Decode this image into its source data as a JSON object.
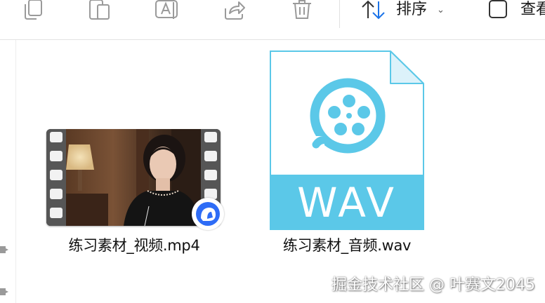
{
  "toolbar": {
    "sort_label": "排序",
    "view_label": "查看",
    "icons": [
      "copy-icon",
      "paste-icon",
      "rename-icon",
      "share-icon",
      "delete-icon",
      "sort-icon",
      "view-icon"
    ]
  },
  "files": [
    {
      "name": "练习素材_视频.mp4",
      "type": "video",
      "icon": "video-thumbnail",
      "badge": "sync-icon"
    },
    {
      "name": "练习素材_音频.wav",
      "type": "audio",
      "icon": "wav-document-icon",
      "label": "WAV"
    }
  ],
  "watermark": "掘金技术社区 @ 叶赛文2045",
  "colors": {
    "wav_accent": "#5bc8e8",
    "badge_blue": "#2e6cf6",
    "icon_gray": "#8a8a8a"
  }
}
